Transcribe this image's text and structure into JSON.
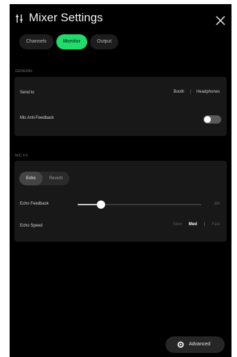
{
  "header": {
    "title": "Mixer Settings"
  },
  "tabs": [
    {
      "label": "Channels",
      "active": false
    },
    {
      "label": "Monitor",
      "active": true
    },
    {
      "label": "Output",
      "active": false
    }
  ],
  "sections": {
    "general_label": "GENERAL",
    "fx_label": "MIC FX"
  },
  "send": {
    "label": "Send to",
    "options": [
      "Booth",
      "Headphones"
    ]
  },
  "mic_feedback": {
    "label": "Mic Anti-Feedback",
    "enabled": false
  },
  "fx_tabs": [
    {
      "label": "Echo",
      "active": true
    },
    {
      "label": "Reverb",
      "active": false
    }
  ],
  "echo_feedback": {
    "label": "Echo Feedback",
    "value": 0.19,
    "max_label": "100"
  },
  "echo_speed": {
    "label": "Echo Speed",
    "options": [
      {
        "label": "Slow",
        "active": false
      },
      {
        "label": "Med",
        "active": true
      },
      {
        "label": "Fast",
        "active": false
      }
    ]
  },
  "footer": {
    "advanced_label": "Advanced"
  },
  "colors": {
    "accent": "#1fdc6b",
    "background": "#000000",
    "card": "#181818"
  }
}
